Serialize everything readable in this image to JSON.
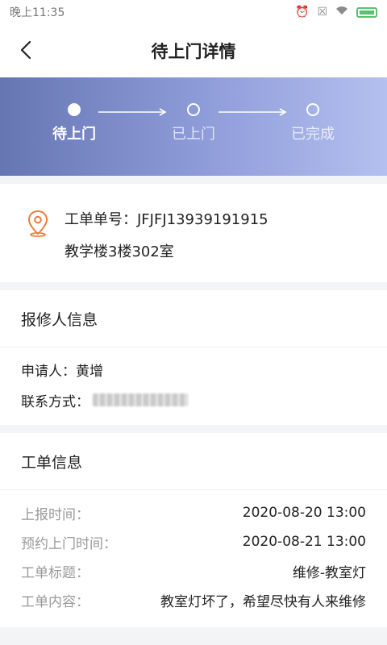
{
  "status_bar": {
    "time": "晚上11:35"
  },
  "nav": {
    "title": "待上门详情"
  },
  "progress": {
    "steps": [
      {
        "label": "待上门",
        "active": true
      },
      {
        "label": "已上门",
        "active": false
      },
      {
        "label": "已完成",
        "active": false
      }
    ]
  },
  "address": {
    "order_no": "工单单号：JFJFJ13939191915",
    "location": "教学楼3楼302室"
  },
  "reporter": {
    "section_title": "报修人信息",
    "applicant_label": "申请人：",
    "applicant_name": "黄增",
    "contact_label": "联系方式："
  },
  "work_order": {
    "section_title": "工单信息",
    "rows": [
      {
        "label": "上报时间：",
        "value": "2020-08-20 13:00"
      },
      {
        "label": "预约上门时间：",
        "value": "2020-08-21 13:00"
      },
      {
        "label": "工单标题：",
        "value": "维修-教室灯"
      },
      {
        "label": "工单内容：",
        "value": "教室灯坏了，希望尽快有人来维修"
      }
    ]
  }
}
